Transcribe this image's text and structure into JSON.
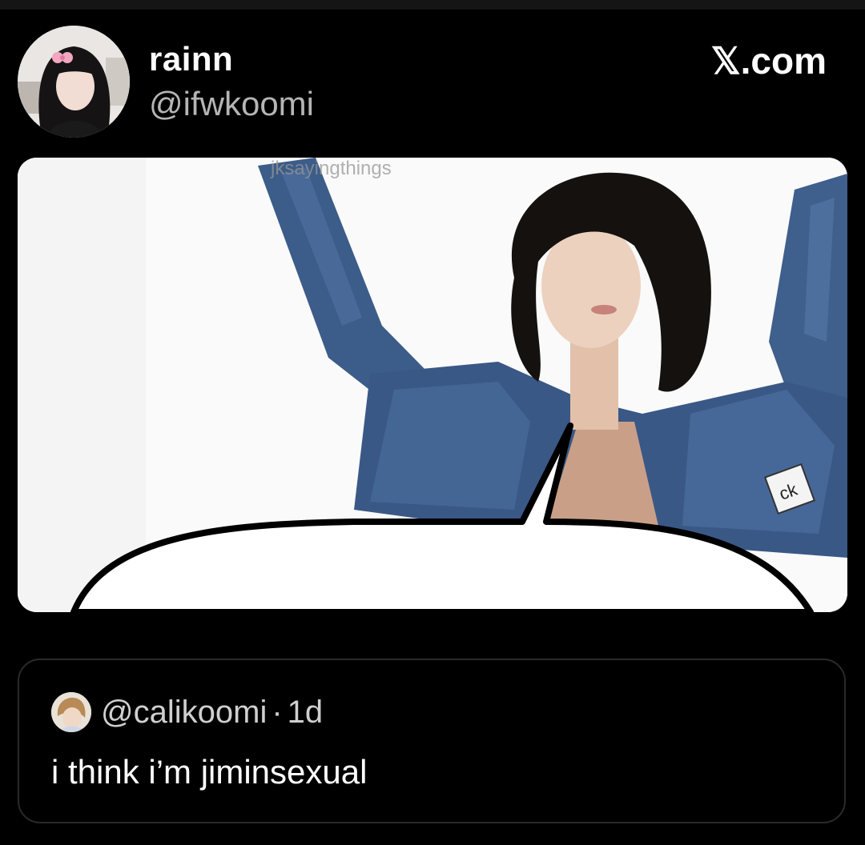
{
  "author": {
    "display_name": "rainn",
    "handle": "@ifwkoomi"
  },
  "brand": "𝕏.com",
  "media": {
    "watermark": "jksayingthings",
    "patch_text": "ck"
  },
  "quoted": {
    "handle": "@calikoomi",
    "separator": "·",
    "time": "1d",
    "text": "i think i’m jiminsexual"
  },
  "colors": {
    "background": "#000000",
    "secondary_text": "#b5b5b5",
    "denim": "#3f5f8c",
    "card_border": "#2a2a2a"
  }
}
